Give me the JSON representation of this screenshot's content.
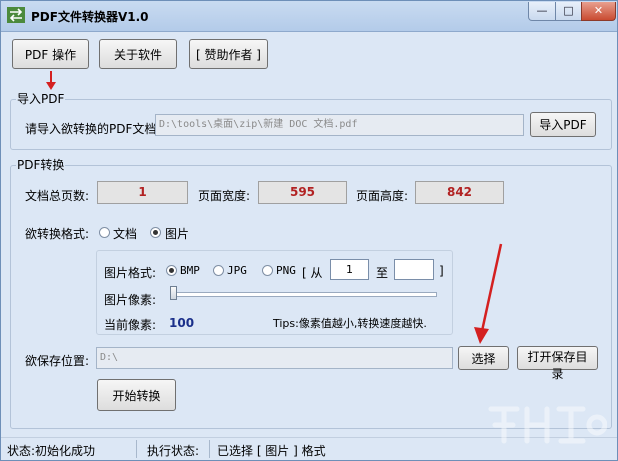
{
  "window": {
    "title": "PDF文件转换器V1.0",
    "minimize": "—",
    "maximize": "□",
    "close": "✕"
  },
  "toolbar": {
    "pdf_ops": "PDF 操作",
    "about": "关于软件",
    "sponsor": "[ 赞助作者 ]"
  },
  "import": {
    "group_label": "导入PDF",
    "prompt": "请导入欲转换的PDF文档:",
    "path": "D:\\tools\\桌面\\zip\\新建 DOC 文档.pdf",
    "button": "导入PDF"
  },
  "convert": {
    "group_label": "PDF转换",
    "pages_label": "文档总页数:",
    "pages_value": "1",
    "width_label": "页面宽度:",
    "width_value": "595",
    "height_label": "页面高度:",
    "height_value": "842",
    "format_label": "欲转换格式:",
    "format_doc": "文档",
    "format_img": "图片",
    "selected_format": "图片",
    "image": {
      "format_label": "图片格式:",
      "bmp": "BMP",
      "jpg": "JPG",
      "png": "PNG",
      "selected": "BMP",
      "range_open": "[ 从",
      "from_value": "1",
      "to_label": "至",
      "to_value": "",
      "range_close": "]",
      "pixel_label": "图片像素:",
      "slider_level": 0,
      "current_label": "当前像素:",
      "current_value": "100",
      "tips": "Tips:像素值越小,转换速度越快."
    },
    "save_label": "欲保存位置:",
    "save_path": "D:\\",
    "choose_button": "选择",
    "open_dir_button": "打开保存目录",
    "start_button": "开始转换"
  },
  "status": {
    "state": "状态:初始化成功",
    "exec_label": "执行状态:",
    "exec_value": "已选择 [ 图片 ] 格式"
  },
  "colors": {
    "annotation_arrow": "#d42020",
    "value_text": "#b22222",
    "pixel_value": "#1a2f8a"
  }
}
